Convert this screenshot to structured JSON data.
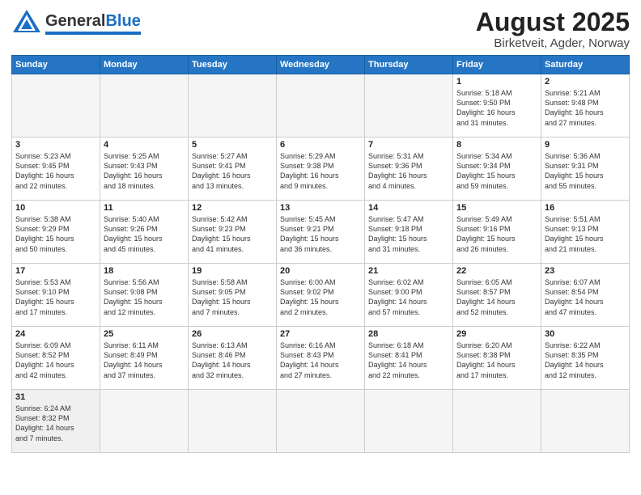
{
  "header": {
    "logo_general": "General",
    "logo_blue": "Blue",
    "title": "August 2025",
    "subtitle": "Birketveit, Agder, Norway"
  },
  "weekdays": [
    "Sunday",
    "Monday",
    "Tuesday",
    "Wednesday",
    "Thursday",
    "Friday",
    "Saturday"
  ],
  "weeks": [
    [
      {
        "day": "",
        "info": ""
      },
      {
        "day": "",
        "info": ""
      },
      {
        "day": "",
        "info": ""
      },
      {
        "day": "",
        "info": ""
      },
      {
        "day": "",
        "info": ""
      },
      {
        "day": "1",
        "info": "Sunrise: 5:18 AM\nSunset: 9:50 PM\nDaylight: 16 hours\nand 31 minutes."
      },
      {
        "day": "2",
        "info": "Sunrise: 5:21 AM\nSunset: 9:48 PM\nDaylight: 16 hours\nand 27 minutes."
      }
    ],
    [
      {
        "day": "3",
        "info": "Sunrise: 5:23 AM\nSunset: 9:45 PM\nDaylight: 16 hours\nand 22 minutes."
      },
      {
        "day": "4",
        "info": "Sunrise: 5:25 AM\nSunset: 9:43 PM\nDaylight: 16 hours\nand 18 minutes."
      },
      {
        "day": "5",
        "info": "Sunrise: 5:27 AM\nSunset: 9:41 PM\nDaylight: 16 hours\nand 13 minutes."
      },
      {
        "day": "6",
        "info": "Sunrise: 5:29 AM\nSunset: 9:38 PM\nDaylight: 16 hours\nand 9 minutes."
      },
      {
        "day": "7",
        "info": "Sunrise: 5:31 AM\nSunset: 9:36 PM\nDaylight: 16 hours\nand 4 minutes."
      },
      {
        "day": "8",
        "info": "Sunrise: 5:34 AM\nSunset: 9:34 PM\nDaylight: 15 hours\nand 59 minutes."
      },
      {
        "day": "9",
        "info": "Sunrise: 5:36 AM\nSunset: 9:31 PM\nDaylight: 15 hours\nand 55 minutes."
      }
    ],
    [
      {
        "day": "10",
        "info": "Sunrise: 5:38 AM\nSunset: 9:29 PM\nDaylight: 15 hours\nand 50 minutes."
      },
      {
        "day": "11",
        "info": "Sunrise: 5:40 AM\nSunset: 9:26 PM\nDaylight: 15 hours\nand 45 minutes."
      },
      {
        "day": "12",
        "info": "Sunrise: 5:42 AM\nSunset: 9:23 PM\nDaylight: 15 hours\nand 41 minutes."
      },
      {
        "day": "13",
        "info": "Sunrise: 5:45 AM\nSunset: 9:21 PM\nDaylight: 15 hours\nand 36 minutes."
      },
      {
        "day": "14",
        "info": "Sunrise: 5:47 AM\nSunset: 9:18 PM\nDaylight: 15 hours\nand 31 minutes."
      },
      {
        "day": "15",
        "info": "Sunrise: 5:49 AM\nSunset: 9:16 PM\nDaylight: 15 hours\nand 26 minutes."
      },
      {
        "day": "16",
        "info": "Sunrise: 5:51 AM\nSunset: 9:13 PM\nDaylight: 15 hours\nand 21 minutes."
      }
    ],
    [
      {
        "day": "17",
        "info": "Sunrise: 5:53 AM\nSunset: 9:10 PM\nDaylight: 15 hours\nand 17 minutes."
      },
      {
        "day": "18",
        "info": "Sunrise: 5:56 AM\nSunset: 9:08 PM\nDaylight: 15 hours\nand 12 minutes."
      },
      {
        "day": "19",
        "info": "Sunrise: 5:58 AM\nSunset: 9:05 PM\nDaylight: 15 hours\nand 7 minutes."
      },
      {
        "day": "20",
        "info": "Sunrise: 6:00 AM\nSunset: 9:02 PM\nDaylight: 15 hours\nand 2 minutes."
      },
      {
        "day": "21",
        "info": "Sunrise: 6:02 AM\nSunset: 9:00 PM\nDaylight: 14 hours\nand 57 minutes."
      },
      {
        "day": "22",
        "info": "Sunrise: 6:05 AM\nSunset: 8:57 PM\nDaylight: 14 hours\nand 52 minutes."
      },
      {
        "day": "23",
        "info": "Sunrise: 6:07 AM\nSunset: 8:54 PM\nDaylight: 14 hours\nand 47 minutes."
      }
    ],
    [
      {
        "day": "24",
        "info": "Sunrise: 6:09 AM\nSunset: 8:52 PM\nDaylight: 14 hours\nand 42 minutes."
      },
      {
        "day": "25",
        "info": "Sunrise: 6:11 AM\nSunset: 8:49 PM\nDaylight: 14 hours\nand 37 minutes."
      },
      {
        "day": "26",
        "info": "Sunrise: 6:13 AM\nSunset: 8:46 PM\nDaylight: 14 hours\nand 32 minutes."
      },
      {
        "day": "27",
        "info": "Sunrise: 6:16 AM\nSunset: 8:43 PM\nDaylight: 14 hours\nand 27 minutes."
      },
      {
        "day": "28",
        "info": "Sunrise: 6:18 AM\nSunset: 8:41 PM\nDaylight: 14 hours\nand 22 minutes."
      },
      {
        "day": "29",
        "info": "Sunrise: 6:20 AM\nSunset: 8:38 PM\nDaylight: 14 hours\nand 17 minutes."
      },
      {
        "day": "30",
        "info": "Sunrise: 6:22 AM\nSunset: 8:35 PM\nDaylight: 14 hours\nand 12 minutes."
      }
    ],
    [
      {
        "day": "31",
        "info": "Sunrise: 6:24 AM\nSunset: 8:32 PM\nDaylight: 14 hours\nand 7 minutes."
      },
      {
        "day": "",
        "info": ""
      },
      {
        "day": "",
        "info": ""
      },
      {
        "day": "",
        "info": ""
      },
      {
        "day": "",
        "info": ""
      },
      {
        "day": "",
        "info": ""
      },
      {
        "day": "",
        "info": ""
      }
    ]
  ]
}
